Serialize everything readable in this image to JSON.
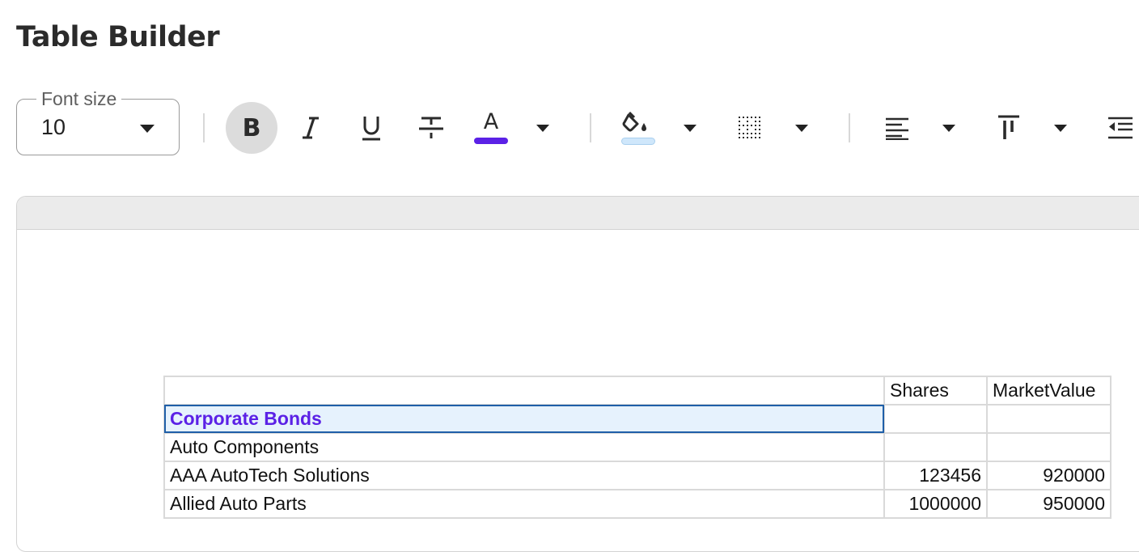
{
  "page": {
    "title": "Table Builder"
  },
  "toolbar": {
    "font_size_label": "Font size",
    "font_size_value": "10",
    "bold_glyph": "B",
    "text_color_glyph": "A",
    "icons": [
      "bold-icon",
      "italic-icon",
      "underline-icon",
      "strikethrough-icon",
      "text-color-icon",
      "fill-color-icon",
      "borders-icon",
      "align-left-icon",
      "vertical-align-top-icon",
      "decrease-indent-icon"
    ],
    "colors": {
      "text_color": "#5b21e6",
      "fill_color": "#cfe7fb",
      "active_button": "#dcdcdc"
    }
  },
  "sheet": {
    "columns": [
      "",
      "Shares",
      "MarketValue"
    ],
    "rows": [
      {
        "name": "Corporate Bonds",
        "shares": "",
        "market_value": ""
      },
      {
        "name": "Auto Components",
        "shares": "",
        "market_value": ""
      },
      {
        "name": "AAA AutoTech Solutions",
        "shares": "123456",
        "market_value": "920000"
      },
      {
        "name": "Allied Auto Parts",
        "shares": "1000000",
        "market_value": "950000"
      }
    ],
    "selected_cell": "Corporate Bonds",
    "selection_color": "#1f5fa8"
  }
}
